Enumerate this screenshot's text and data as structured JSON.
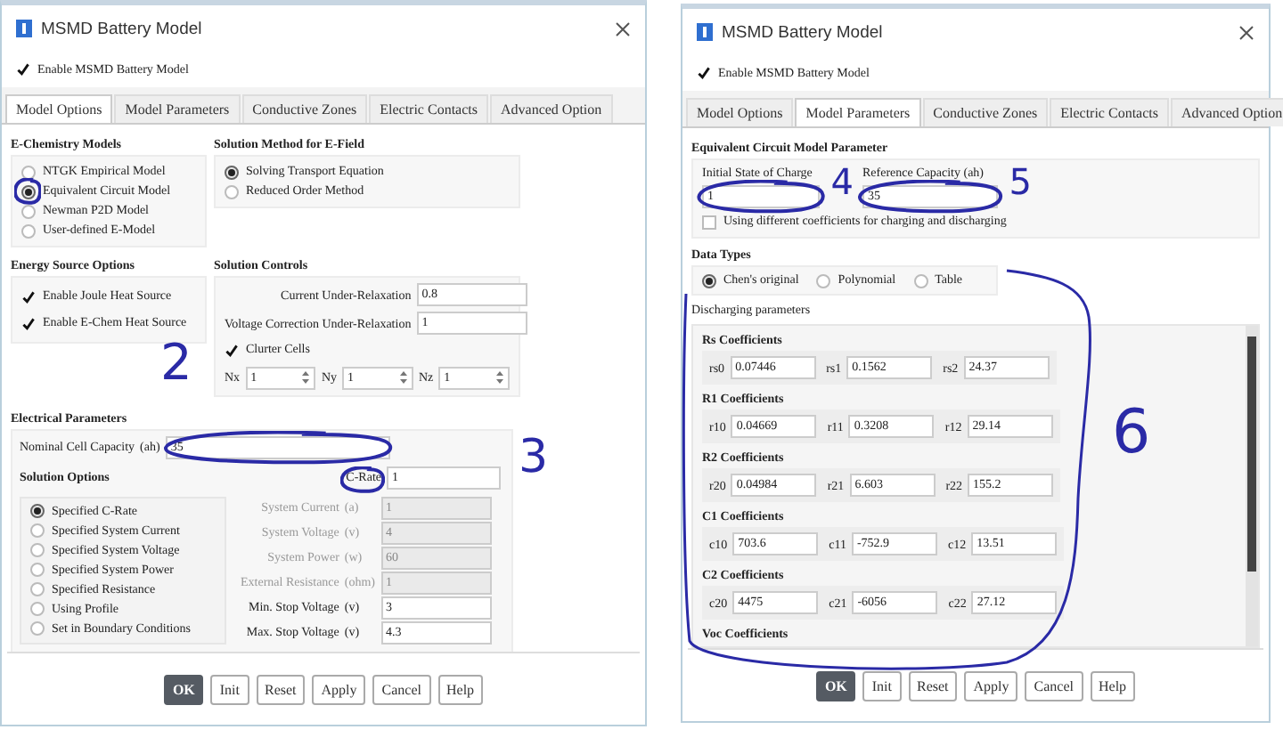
{
  "dialogs": [
    {
      "kind": "model_options",
      "title": "MSMD Battery Model",
      "enable": {
        "label": "Enable MSMD Battery Model",
        "checked": true
      },
      "tabs": [
        {
          "label": "Model Options",
          "selected": true
        },
        {
          "label": "Model Parameters",
          "selected": false
        },
        {
          "label": "Conductive Zones",
          "selected": false
        },
        {
          "label": "Electric Contacts",
          "selected": false
        },
        {
          "label": "Advanced Option",
          "selected": false
        }
      ],
      "echem": {
        "title": "E-Chemistry Models",
        "options": [
          {
            "label": "NTGK Empirical Model",
            "selected": false
          },
          {
            "label": "Equivalent Circuit Model",
            "selected": true
          },
          {
            "label": "Newman P2D Model",
            "selected": false
          },
          {
            "label": "User-defined E-Model",
            "selected": false
          }
        ]
      },
      "solution_method": {
        "title": "Solution Method for E-Field",
        "options": [
          {
            "label": "Solving Transport Equation",
            "selected": true
          },
          {
            "label": "Reduced Order Method",
            "selected": false
          }
        ]
      },
      "energy": {
        "title": "Energy Source Options",
        "options": [
          {
            "label": "Enable Joule Heat Source",
            "checked": true
          },
          {
            "label": "Enable E-Chem Heat Source",
            "checked": true
          }
        ]
      },
      "controls": {
        "title": "Solution Controls",
        "fields": [
          {
            "label": "Current Under-Relaxation",
            "value": "0.8"
          },
          {
            "label": "Voltage Correction Under-Relaxation",
            "value": "1"
          }
        ],
        "cluster": {
          "label": "Clurter Cells",
          "checked": true
        },
        "spinners": [
          {
            "label": "Nx",
            "value": "1"
          },
          {
            "label": "Ny",
            "value": "1"
          },
          {
            "label": "Nz",
            "value": "1"
          }
        ]
      },
      "electrical": {
        "title": "Electrical Parameters",
        "capacity": {
          "label": "Nominal Cell Capacity",
          "unit": "(ah)",
          "value": "35"
        },
        "options_title": "Solution Options",
        "c_rate": {
          "label": "C-Rate",
          "value": "1"
        },
        "options": [
          {
            "label": "Specified C-Rate",
            "selected": true
          },
          {
            "label": "Specified System Current",
            "selected": false
          },
          {
            "label": "Specified System Voltage",
            "selected": false
          },
          {
            "label": "Specified System Power",
            "selected": false
          },
          {
            "label": "Specified Resistance",
            "selected": false
          },
          {
            "label": "Using Profile",
            "selected": false
          },
          {
            "label": "Set in Boundary Conditions",
            "selected": false
          }
        ],
        "fields": [
          {
            "label": "System Current",
            "unit": "(a)",
            "value": "1",
            "disabled": true
          },
          {
            "label": "System Voltage",
            "unit": "(v)",
            "value": "4",
            "disabled": true
          },
          {
            "label": "System Power",
            "unit": "(w)",
            "value": "60",
            "disabled": true
          },
          {
            "label": "External Resistance",
            "unit": "(ohm)",
            "value": "1",
            "disabled": true
          },
          {
            "label": "Min. Stop Voltage",
            "unit": "(v)",
            "value": "3",
            "disabled": false
          },
          {
            "label": "Max. Stop Voltage",
            "unit": "(v)",
            "value": "4.3",
            "disabled": false
          }
        ]
      },
      "buttons": [
        {
          "label": "OK",
          "default": true
        },
        {
          "label": "Init",
          "default": false
        },
        {
          "label": "Reset",
          "default": false
        },
        {
          "label": "Apply",
          "default": false
        },
        {
          "label": "Cancel",
          "default": false
        },
        {
          "label": "Help",
          "default": false
        }
      ]
    },
    {
      "kind": "model_parameters",
      "title": "MSMD Battery Model",
      "enable": {
        "label": "Enable MSMD Battery Model",
        "checked": true
      },
      "tabs": [
        {
          "label": "Model Options",
          "selected": false
        },
        {
          "label": "Model Parameters",
          "selected": true
        },
        {
          "label": "Conductive Zones",
          "selected": false
        },
        {
          "label": "Electric Contacts",
          "selected": false
        },
        {
          "label": "Advanced Option",
          "selected": false
        }
      ],
      "ecm": {
        "title": "Equivalent Circuit Model Parameter",
        "fields": [
          {
            "label": "Initial State of Charge",
            "value": "1"
          },
          {
            "label": "Reference Capacity (ah)",
            "value": "35"
          }
        ],
        "different_coefficients": {
          "label": "Using different coefficients for charging and discharging",
          "checked": false
        }
      },
      "data_types": {
        "title": "Data Types",
        "options": [
          {
            "label": "Chen's original",
            "selected": true
          },
          {
            "label": "Polynomial",
            "selected": false
          },
          {
            "label": "Table",
            "selected": false
          }
        ]
      },
      "discharging": {
        "title": "Discharging parameters",
        "groups": [
          {
            "title": "Rs Coefficients",
            "fields": [
              {
                "label": "rs0",
                "value": "0.07446"
              },
              {
                "label": "rs1",
                "value": "0.1562"
              },
              {
                "label": "rs2",
                "value": "24.37"
              }
            ]
          },
          {
            "title": "R1 Coefficients",
            "fields": [
              {
                "label": "r10",
                "value": "0.04669"
              },
              {
                "label": "r11",
                "value": "0.3208"
              },
              {
                "label": "r12",
                "value": "29.14"
              }
            ]
          },
          {
            "title": "R2 Coefficients",
            "fields": [
              {
                "label": "r20",
                "value": "0.04984"
              },
              {
                "label": "r21",
                "value": "6.603"
              },
              {
                "label": "r22",
                "value": "155.2"
              }
            ]
          },
          {
            "title": "C1 Coefficients",
            "fields": [
              {
                "label": "c10",
                "value": "703.6"
              },
              {
                "label": "c11",
                "value": "-752.9"
              },
              {
                "label": "c12",
                "value": "13.51"
              }
            ]
          },
          {
            "title": "C2 Coefficients",
            "fields": [
              {
                "label": "c20",
                "value": "4475"
              },
              {
                "label": "c21",
                "value": "-6056"
              },
              {
                "label": "c22",
                "value": "27.12"
              }
            ]
          },
          {
            "title": "Voc Coefficients"
          }
        ]
      },
      "buttons": [
        {
          "label": "OK",
          "default": true
        },
        {
          "label": "Init",
          "default": false
        },
        {
          "label": "Reset",
          "default": false
        },
        {
          "label": "Apply",
          "default": false
        },
        {
          "label": "Cancel",
          "default": false
        },
        {
          "label": "Help",
          "default": false
        }
      ]
    }
  ],
  "annotations": [
    {
      "label": "2"
    },
    {
      "label": "3"
    },
    {
      "label": "4"
    },
    {
      "label": "5"
    },
    {
      "label": "6"
    }
  ]
}
